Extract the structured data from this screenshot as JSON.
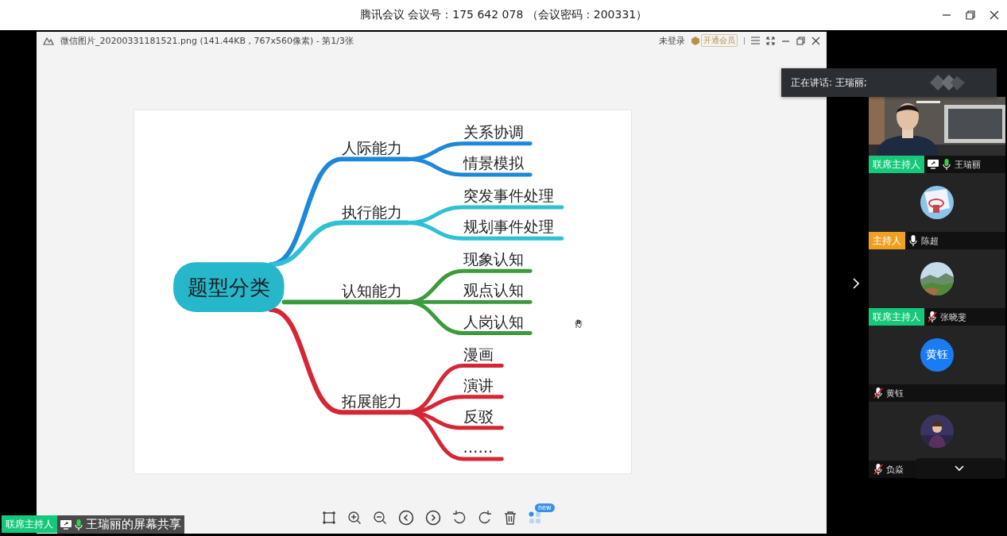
{
  "app_title": "腾讯会议 会议号：175 642 078 （会议密码：200331）",
  "viewer": {
    "file_info": "微信图片_20200331181521.png (141.44KB , 767x560像素) - 第1/3张",
    "login_status": "未登录",
    "vip_button": "开通会员",
    "mindmap": {
      "root": "题型分类",
      "branches": [
        {
          "label": "人际能力",
          "color": "#1e88d8",
          "children": [
            "关系协调",
            "情景模拟"
          ]
        },
        {
          "label": "执行能力",
          "color": "#2ec0d4",
          "children": [
            "突发事件处理",
            "规划事件处理"
          ]
        },
        {
          "label": "认知能力",
          "color": "#3b9a3b",
          "children": [
            "现象认知",
            "观点认知",
            "人岗认知"
          ]
        },
        {
          "label": "拓展能力",
          "color": "#d62636",
          "children": [
            "漫画",
            "演讲",
            "反驳",
            "……"
          ]
        }
      ]
    },
    "toolbar_badge": "new"
  },
  "screen_share": {
    "role": {
      "label": "联席主持人",
      "color": "#14c97a"
    },
    "label": "王瑞丽的屏幕共享"
  },
  "speaking": "正在讲话: 王瑞丽;",
  "participants": [
    {
      "name": "王瑞丽",
      "role": {
        "label": "联席主持人",
        "color": "#14c97a"
      },
      "sharing": true,
      "muted": false,
      "speaking": true,
      "avatar": {
        "kind": "video"
      }
    },
    {
      "name": "陈超",
      "role": {
        "label": "主持人",
        "color": "#f0a020"
      },
      "sharing": false,
      "muted": false,
      "speaking": false
    },
    {
      "name": "张晓斐",
      "role": {
        "label": "联席主持人",
        "color": "#14c97a"
      },
      "sharing": false,
      "muted": true,
      "speaking": false
    },
    {
      "name": "黄钰",
      "sharing": false,
      "muted": true,
      "speaking": false,
      "avatar": {
        "kind": "initials",
        "text": "黄钰"
      }
    },
    {
      "name": "负焱",
      "sharing": false,
      "muted": true,
      "speaking": false
    }
  ]
}
